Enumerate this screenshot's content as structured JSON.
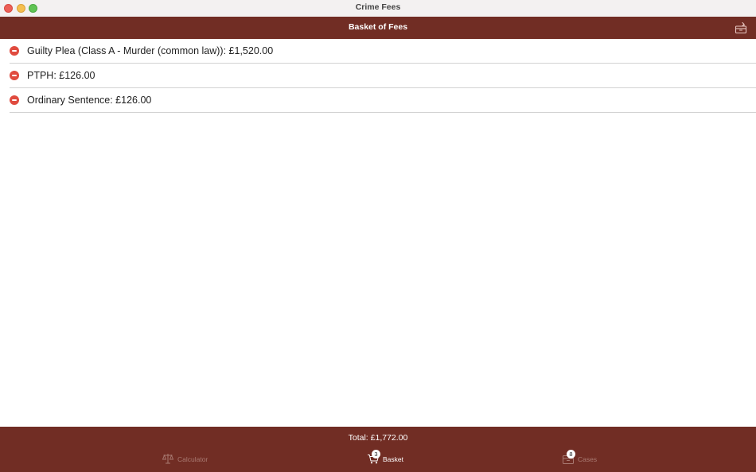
{
  "window": {
    "title": "Crime Fees"
  },
  "navbar": {
    "title": "Basket of Fees",
    "action_icon": "archive-box-icon"
  },
  "basket_items": [
    {
      "label": "Guilty Plea (Class A - Murder (common law)): £1,520.00"
    },
    {
      "label": "PTPH: £126.00"
    },
    {
      "label": "Ordinary Sentence: £126.00"
    }
  ],
  "footer": {
    "total": "Total: £1,772.00"
  },
  "tabs": {
    "calculator": {
      "label": "Calculator",
      "icon": "scales-icon"
    },
    "basket": {
      "label": "Basket",
      "icon": "cart-icon",
      "badge": "3"
    },
    "cases": {
      "label": "Cases",
      "icon": "archive-box-icon",
      "badge": "8"
    }
  },
  "colors": {
    "brand": "#712d24",
    "delete": "#e04b3f"
  }
}
